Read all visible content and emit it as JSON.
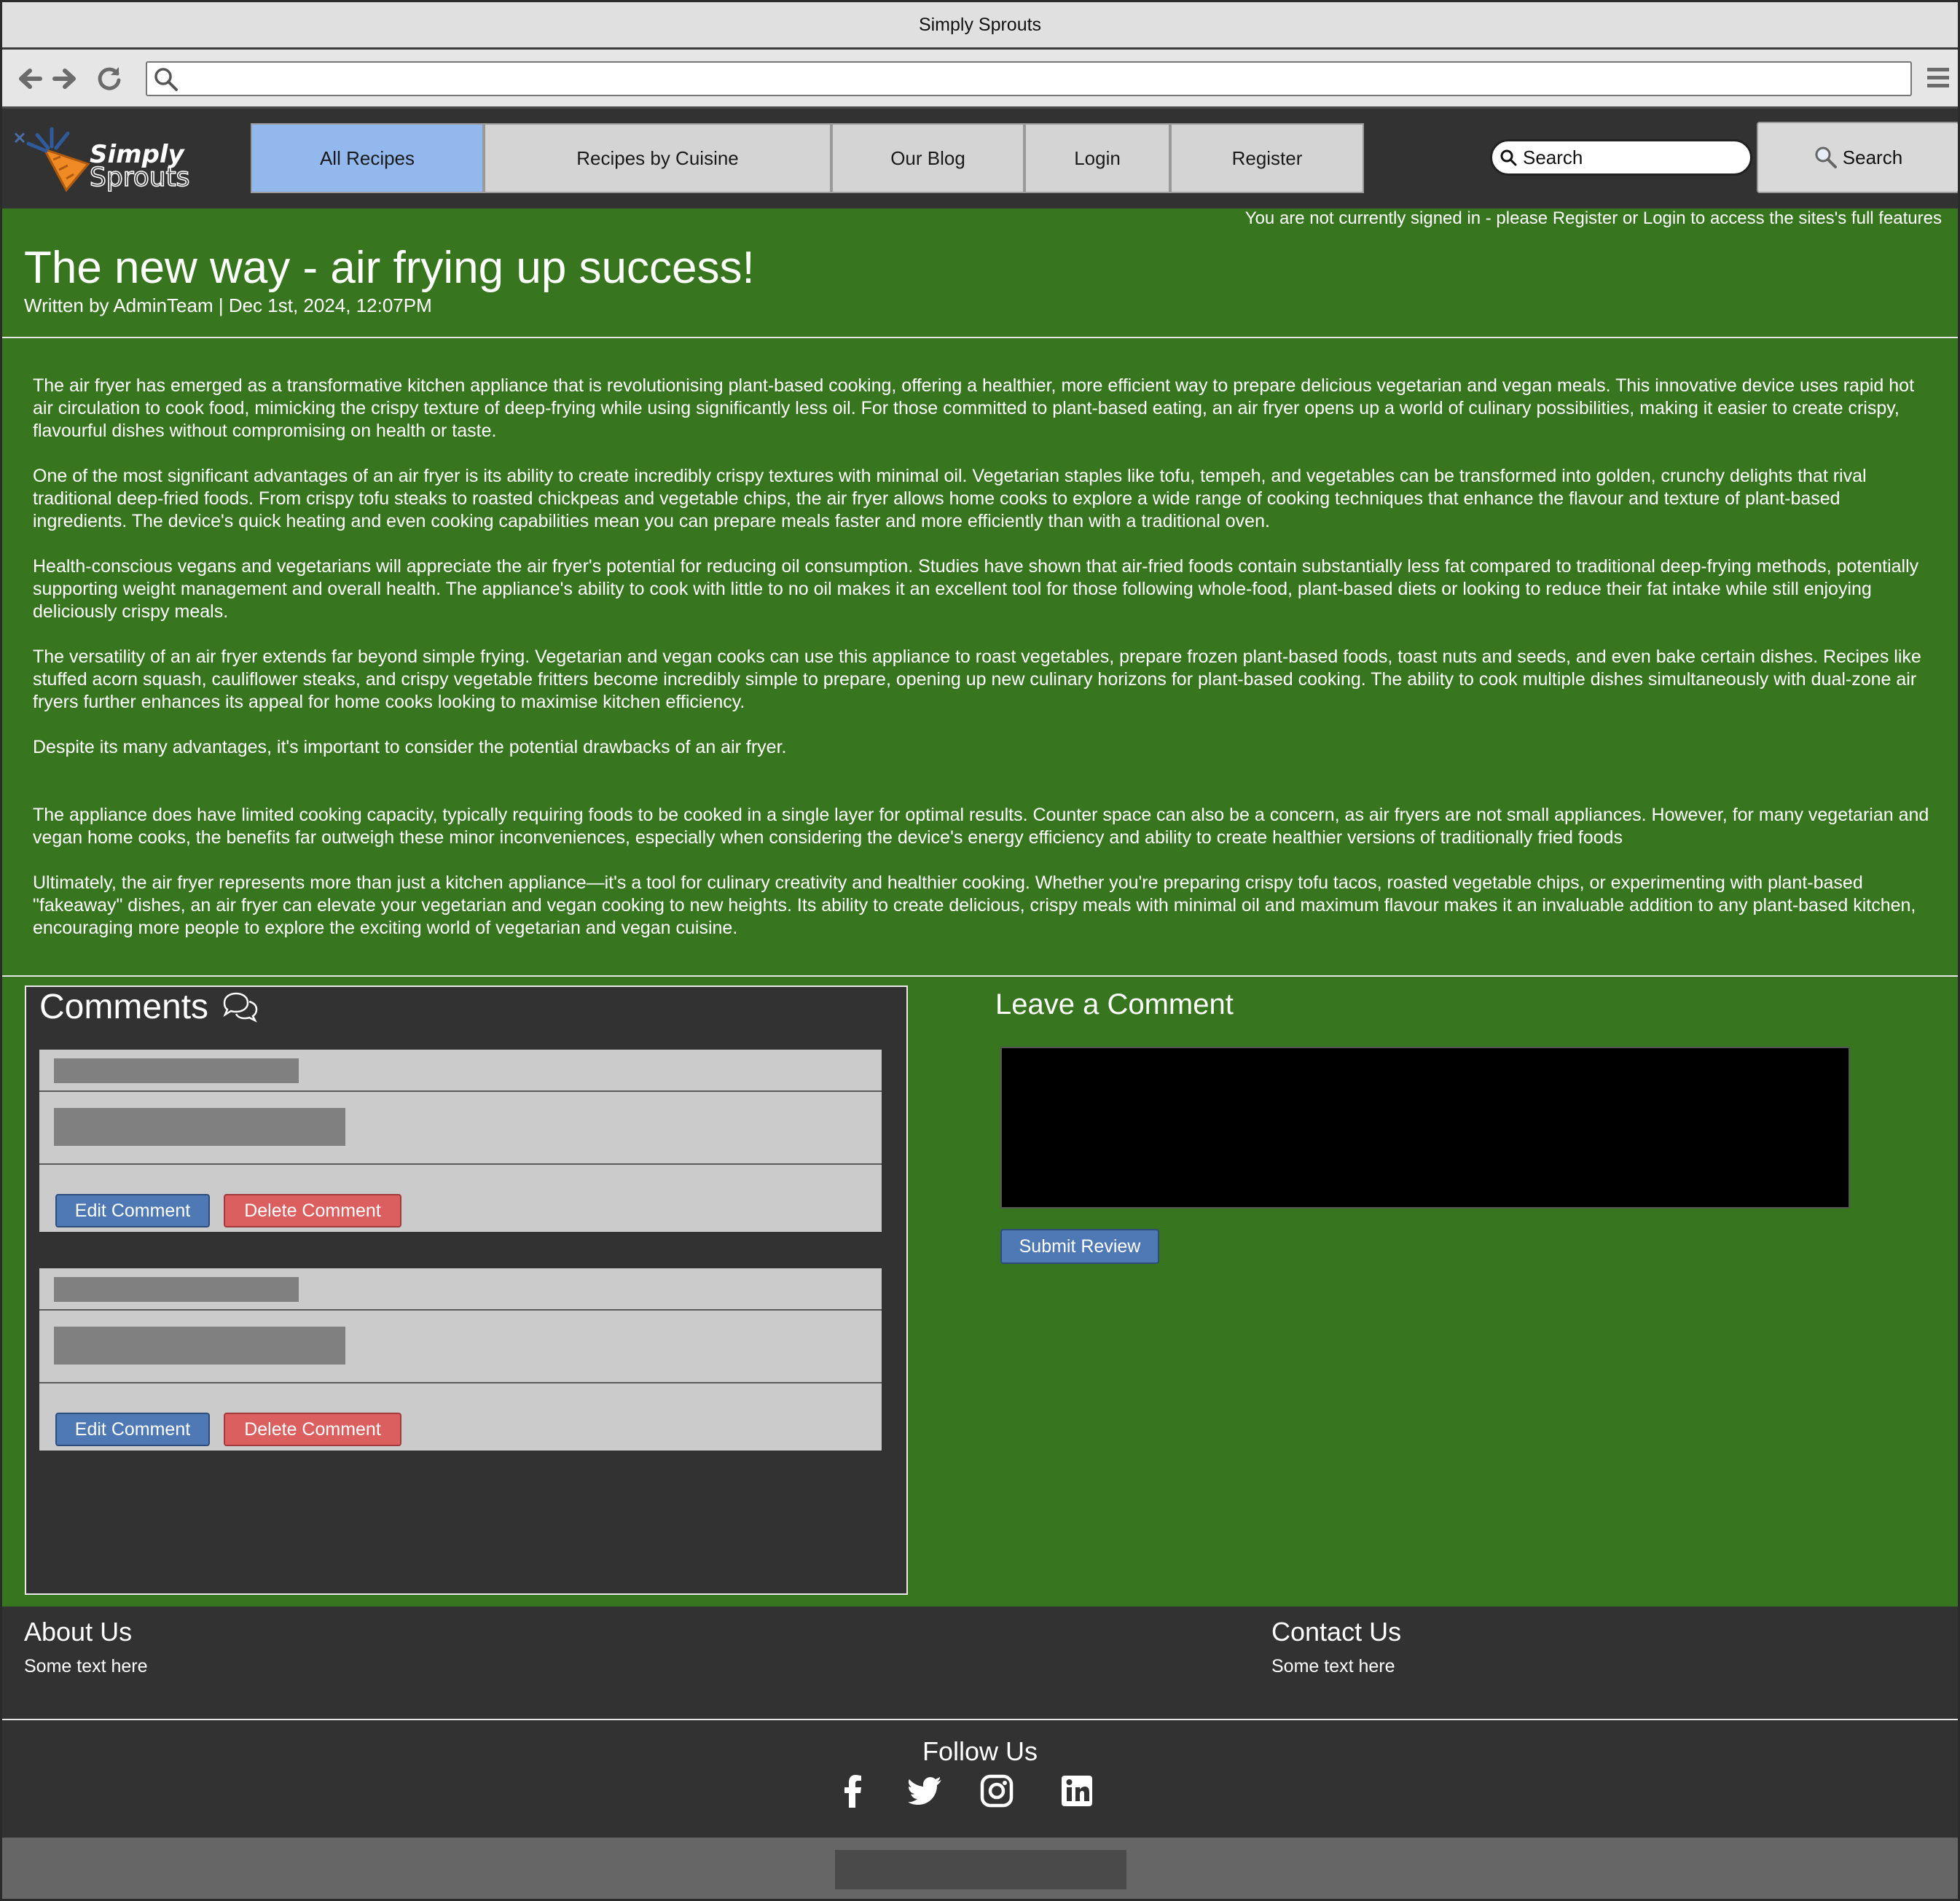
{
  "browser": {
    "window_title": "Simply Sprouts",
    "url": ""
  },
  "logo": {
    "line1": "Simply",
    "line2": "Sprouts"
  },
  "nav": {
    "tabs": [
      {
        "label": "All Recipes",
        "active": true
      },
      {
        "label": "Recipes by Cuisine",
        "active": false
      },
      {
        "label": "Our Blog",
        "active": false
      },
      {
        "label": "Login",
        "active": false
      },
      {
        "label": "Register",
        "active": false
      }
    ],
    "search_placeholder": "Search",
    "search_button": "Search"
  },
  "status": {
    "signin_note": "You are not currently signed in - please Register or Login to access the sites's full features"
  },
  "post": {
    "title": "The new way - air frying up success!",
    "meta": "Written by AdminTeam | Dec 1st, 2024, 12:07PM",
    "paragraphs": [
      "The air fryer has emerged as a transformative kitchen appliance that is revolutionising plant-based cooking, offering a healthier, more efficient way to prepare delicious vegetarian and vegan meals. This innovative device uses rapid hot air circulation to cook food, mimicking the crispy texture of deep-frying while using significantly less oil. For those committed to plant-based eating, an air fryer opens up a world of culinary possibilities, making it easier to create crispy, flavourful dishes without compromising on health or taste.",
      "One of the most significant advantages of an air fryer is its ability to create incredibly crispy textures with minimal oil. Vegetarian staples like tofu, tempeh, and vegetables can be transformed into golden, crunchy delights that rival traditional deep-fried foods. From crispy tofu steaks to roasted chickpeas and vegetable chips, the air fryer allows home cooks to explore a wide range of cooking techniques that enhance the flavour and texture of plant-based ingredients. The device's quick heating and even cooking capabilities mean you can prepare meals faster and more efficiently than with a traditional oven.",
      "Health-conscious vegans and vegetarians will appreciate the air fryer's potential for reducing oil consumption. Studies have shown that air-fried foods contain substantially less fat compared to traditional deep-frying methods, potentially supporting weight management and overall health. The appliance's ability to cook with little to no oil makes it an excellent tool for those following whole-food, plant-based diets or looking to reduce their fat intake while still enjoying deliciously crispy meals.",
      "The versatility of an air fryer extends far beyond simple frying. Vegetarian and vegan cooks can use this appliance to roast vegetables, prepare frozen plant-based foods, toast nuts and seeds, and even bake certain dishes. Recipes like stuffed acorn squash, cauliflower steaks, and crispy vegetable fritters become incredibly simple to prepare, opening up new culinary horizons for plant-based cooking. The ability to cook multiple dishes simultaneously with dual-zone air fryers further enhances its appeal for home cooks looking to maximise kitchen efficiency.",
      "Despite its many advantages, it's important to consider the potential drawbacks of an air fryer.",
      "The appliance does have limited cooking capacity, typically requiring foods to be cooked in a single layer for optimal results. Counter space can also be a concern, as air fryers are not small appliances. However, for many vegetarian and vegan home cooks, the benefits far outweigh these minor inconveniences, especially when considering the device's energy efficiency and ability to create healthier versions of traditionally fried foods",
      "Ultimately, the air fryer represents more than just a kitchen appliance—it's a tool for culinary creativity and healthier cooking. Whether you're preparing crispy tofu tacos, roasted vegetable chips, or experimenting with plant-based \"fakeaway\" dishes, an air fryer can elevate your vegetarian and vegan cooking to new heights. Its ability to create delicious, crispy meals with minimal oil and maximum flavour makes it an invaluable addition to any plant-based kitchen, encouraging more people to explore the exciting world of vegetarian and vegan cuisine."
    ]
  },
  "comments": {
    "title": "Comments",
    "icon": "chat-bubbles-icon",
    "items": [
      {
        "edit_label": "Edit Comment",
        "delete_label": "Delete Comment"
      },
      {
        "edit_label": "Edit Comment",
        "delete_label": "Delete Comment"
      }
    ]
  },
  "leave_comment": {
    "title": "Leave a Comment",
    "submit_label": "Submit Review"
  },
  "footer": {
    "about_title": "About Us",
    "about_text": "Some text here",
    "contact_title": "Contact Us",
    "contact_text": "Some text here",
    "follow_title": "Follow Us",
    "social_icons": [
      "facebook-icon",
      "twitter-icon",
      "instagram-icon",
      "linkedin-icon"
    ]
  },
  "colors": {
    "main_green": "#37761f",
    "dark_bg": "#323232",
    "active_tab": "#92b8ee",
    "edit_button": "#4e79b4",
    "delete_button": "#dc5f5f"
  }
}
